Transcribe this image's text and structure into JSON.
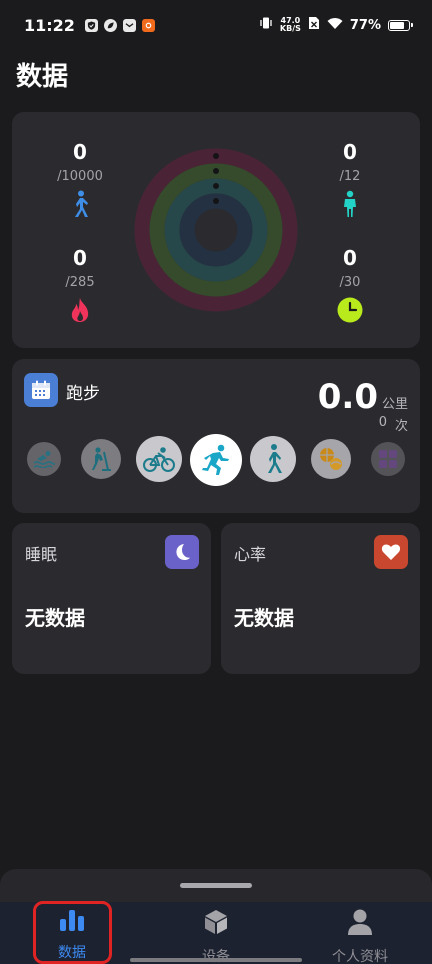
{
  "status_bar": {
    "time": "11:22",
    "net_speed_value": "47.0",
    "net_speed_unit": "KB/S",
    "battery": "77%",
    "battery_level": 0.77,
    "notification_icons": [
      "shield-check-icon",
      "leaf-icon",
      "mail-icon",
      "app-badge-icon"
    ]
  },
  "page": {
    "title": "数据"
  },
  "activity": {
    "steps": {
      "value": "0",
      "goal": "/10000",
      "icon": "walking-icon",
      "color": "#3e8ee8"
    },
    "calories": {
      "value": "0",
      "goal": "/285",
      "icon": "flame-icon",
      "color": "#f0335a"
    },
    "stand": {
      "value": "0",
      "goal": "/12",
      "icon": "standing-icon",
      "color": "#23d3c7"
    },
    "exercise": {
      "value": "0",
      "goal": "/30",
      "icon": "clock-icon",
      "color": "#b8ea1c"
    },
    "ring_colors": [
      "#4a2436",
      "#364a2c",
      "#27484a",
      "#233142"
    ]
  },
  "running": {
    "title": "跑步",
    "distance": "0.0",
    "distance_unit": "公里",
    "count": "0",
    "count_unit": "次",
    "sports": [
      {
        "name": "swimming-icon",
        "selected": false
      },
      {
        "name": "elliptical-icon",
        "selected": false
      },
      {
        "name": "cycling-icon",
        "selected": false
      },
      {
        "name": "running-icon",
        "selected": true
      },
      {
        "name": "walking-icon",
        "selected": false
      },
      {
        "name": "ball-sports-icon",
        "selected": false
      },
      {
        "name": "more-sports-icon",
        "selected": false
      }
    ]
  },
  "sleep": {
    "label": "睡眠",
    "value": "无数据",
    "icon": "moon-icon",
    "color": "#6b62c9"
  },
  "heart": {
    "label": "心率",
    "value": "无数据",
    "icon": "heart-icon",
    "color": "#c9472e"
  },
  "nav": {
    "items": [
      {
        "label": "数据",
        "icon": "bar-chart-icon",
        "active": true
      },
      {
        "label": "设备",
        "icon": "cube-icon",
        "active": false
      },
      {
        "label": "个人资料",
        "icon": "person-icon",
        "active": false
      }
    ]
  }
}
